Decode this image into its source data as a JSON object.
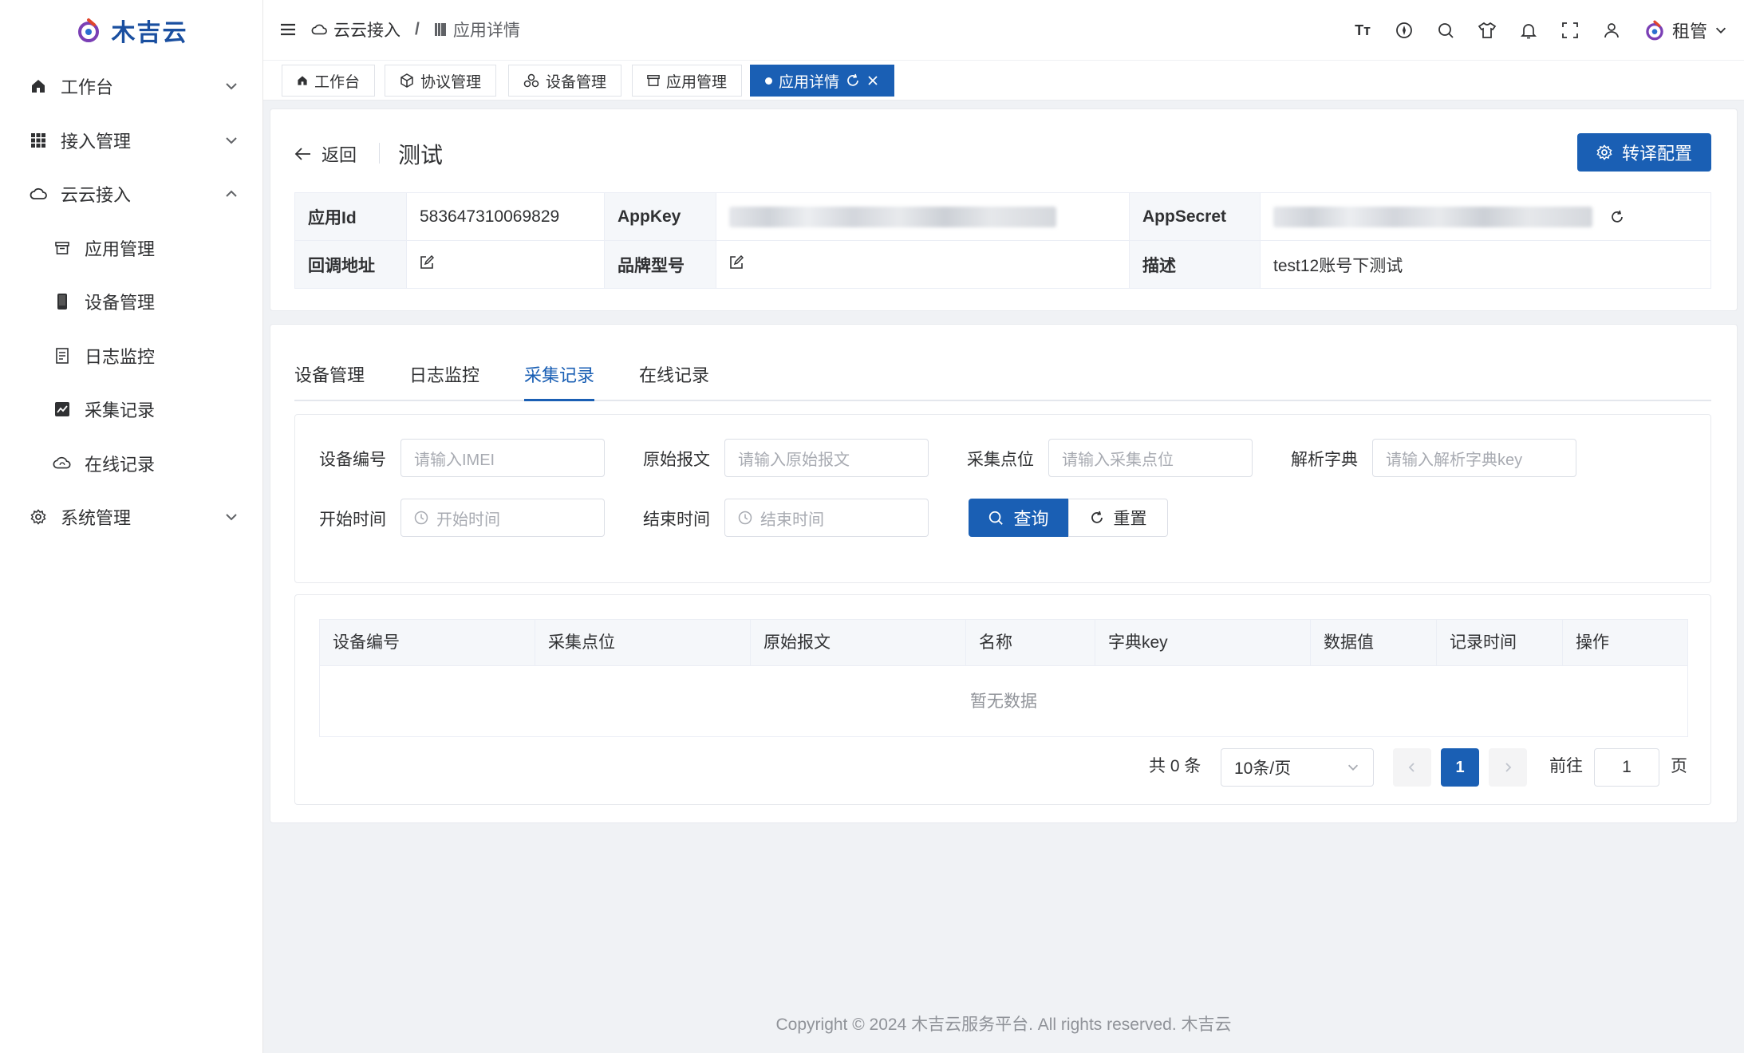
{
  "app": {
    "brand": "木吉云",
    "accent": "#1a5fb4"
  },
  "sidebar": {
    "items": [
      {
        "label": "工作台",
        "icon": "home-icon"
      },
      {
        "label": "接入管理",
        "icon": "grid-icon"
      },
      {
        "label": "云云接入",
        "icon": "cloud-icon"
      },
      {
        "label": "应用管理",
        "icon": "archive-icon"
      },
      {
        "label": "设备管理",
        "icon": "phone-icon"
      },
      {
        "label": "日志监控",
        "icon": "document-icon"
      },
      {
        "label": "采集记录",
        "icon": "chart-icon"
      },
      {
        "label": "在线记录",
        "icon": "cloud-sync-icon"
      },
      {
        "label": "系统管理",
        "icon": "gear-icon"
      }
    ]
  },
  "header": {
    "breadcrumb": [
      "云云接入",
      "应用详情"
    ],
    "sep": "/",
    "font_tool": "Tт",
    "user": "租管"
  },
  "tags": [
    "工作台",
    "协议管理",
    "设备管理",
    "应用管理",
    "应用详情"
  ],
  "detail": {
    "back": "返回",
    "title": "测试",
    "config_button": "转译配置",
    "fields": {
      "app_id_label": "应用Id",
      "app_id": "583647310069829",
      "appkey_label": "AppKey",
      "appsecret_label": "AppSecret",
      "callback_label": "回调地址",
      "brand_label": "品牌型号",
      "desc_label": "描述",
      "desc": "test12账号下测试"
    }
  },
  "tabs": [
    "设备管理",
    "日志监控",
    "采集记录",
    "在线记录"
  ],
  "active_tab": "采集记录",
  "filters": {
    "imei_label": "设备编号",
    "imei_ph": "请输入IMEI",
    "raw_label": "原始报文",
    "raw_ph": "请输入原始报文",
    "point_label": "采集点位",
    "point_ph": "请输入采集点位",
    "dict_label": "解析字典",
    "dict_ph": "请输入解析字典key",
    "start_label": "开始时间",
    "start_ph": "开始时间",
    "end_label": "结束时间",
    "end_ph": "结束时间",
    "query": "查询",
    "reset": "重置"
  },
  "table": {
    "columns": [
      "设备编号",
      "采集点位",
      "原始报文",
      "名称",
      "字典key",
      "数据值",
      "记录时间",
      "操作"
    ],
    "empty": "暂无数据"
  },
  "pagination": {
    "total": "共 0 条",
    "page_size": "10条/页",
    "current": "1",
    "goto": "前往",
    "goto_value": "1",
    "page_unit": "页"
  },
  "footer": "Copyright © 2024 木吉云服务平台. All rights reserved. 木吉云"
}
